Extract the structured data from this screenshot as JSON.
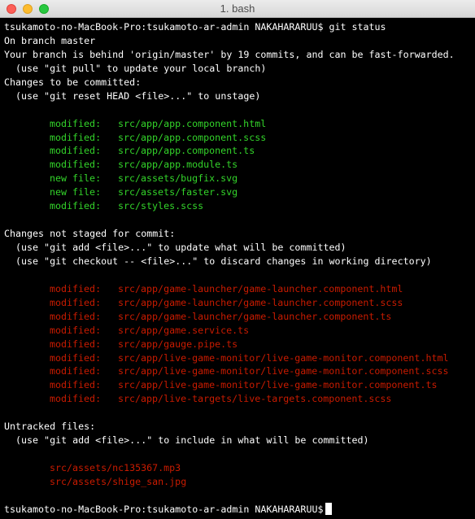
{
  "window": {
    "title": "1. bash"
  },
  "terminal": {
    "prompt": "tsukamoto-no-MacBook-Pro:tsukamoto-ar-admin NAKAHARARUU$",
    "command": " git status",
    "on_branch": "On branch master",
    "behind_msg": "Your branch is behind 'origin/master' by 19 commits, and can be fast-forwarded.",
    "pull_hint": "  (use \"git pull\" to update your local branch)",
    "staged_header": "Changes to be committed:",
    "staged_hint": "  (use \"git reset HEAD <file>...\" to unstage)",
    "staged_files": [
      {
        "status": "modified:",
        "path": "src/app/app.component.html"
      },
      {
        "status": "modified:",
        "path": "src/app/app.component.scss"
      },
      {
        "status": "modified:",
        "path": "src/app/app.component.ts"
      },
      {
        "status": "modified:",
        "path": "src/app/app.module.ts"
      },
      {
        "status": "new file:",
        "path": "src/assets/bugfix.svg"
      },
      {
        "status": "new file:",
        "path": "src/assets/faster.svg"
      },
      {
        "status": "modified:",
        "path": "src/styles.scss"
      }
    ],
    "unstaged_header": "Changes not staged for commit:",
    "unstaged_hint_1": "  (use \"git add <file>...\" to update what will be committed)",
    "unstaged_hint_2": "  (use \"git checkout -- <file>...\" to discard changes in working directory)",
    "unstaged_files": [
      {
        "status": "modified:",
        "path": "src/app/game-launcher/game-launcher.component.html"
      },
      {
        "status": "modified:",
        "path": "src/app/game-launcher/game-launcher.component.scss"
      },
      {
        "status": "modified:",
        "path": "src/app/game-launcher/game-launcher.component.ts"
      },
      {
        "status": "modified:",
        "path": "src/app/game.service.ts"
      },
      {
        "status": "modified:",
        "path": "src/app/gauge.pipe.ts"
      },
      {
        "status": "modified:",
        "path": "src/app/live-game-monitor/live-game-monitor.component.html"
      },
      {
        "status": "modified:",
        "path": "src/app/live-game-monitor/live-game-monitor.component.scss"
      },
      {
        "status": "modified:",
        "path": "src/app/live-game-monitor/live-game-monitor.component.ts"
      },
      {
        "status": "modified:",
        "path": "src/app/live-targets/live-targets.component.scss"
      }
    ],
    "untracked_header": "Untracked files:",
    "untracked_hint": "  (use \"git add <file>...\" to include in what will be committed)",
    "untracked_files": [
      "src/assets/nc135367.mp3",
      "src/assets/shige_san.jpg"
    ]
  },
  "colors": {
    "staged": "#33d42a",
    "unstaged": "#c91b00",
    "background": "#000000",
    "text": "#ffffff"
  }
}
